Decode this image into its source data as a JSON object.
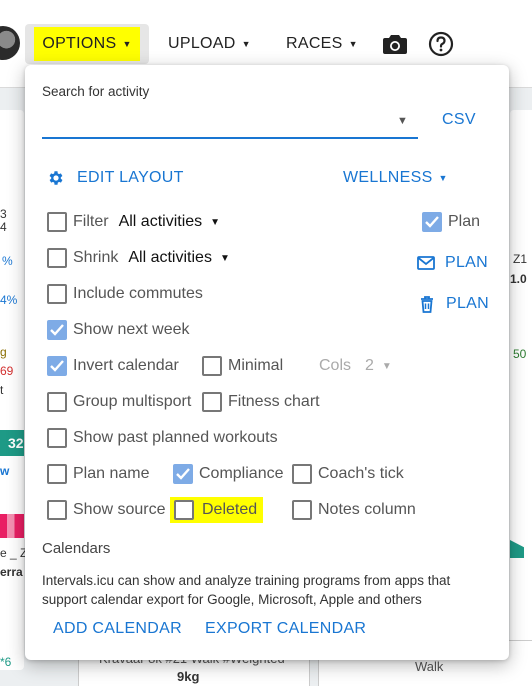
{
  "topbar": {
    "options_label": "OPTIONS",
    "upload_label": "UPLOAD",
    "races_label": "RACES"
  },
  "background": {
    "left_fragments": [
      "3",
      "4",
      "%",
      "4%",
      "g",
      "69",
      "t",
      "32",
      "w",
      "e _ Z",
      "erra",
      "*6"
    ],
    "right_fragments": [
      "Z1",
      "1.0",
      "50"
    ],
    "bottom_card_left": "Kravaar 8k #21 Walk #Weighted",
    "bottom_card_left_line2": "9kg",
    "bottom_card_right": "Walk"
  },
  "panel": {
    "search_label": "Search for activity",
    "search_value": "",
    "csv_label": "CSV",
    "edit_layout_label": "EDIT LAYOUT",
    "wellness_label": "WELLNESS",
    "filter": {
      "label": "Filter",
      "value": "All activities",
      "checked": false
    },
    "shrink": {
      "label": "Shrink",
      "value": "All activities",
      "checked": false
    },
    "plan_checkbox": {
      "label": "Plan",
      "checked": true
    },
    "plan_email_label": "PLAN",
    "plan_delete_label": "PLAN",
    "include_commutes": {
      "label": "Include commutes",
      "checked": false
    },
    "show_next_week": {
      "label": "Show next week",
      "checked": true
    },
    "invert_calendar": {
      "label": "Invert calendar",
      "checked": true
    },
    "minimal": {
      "label": "Minimal",
      "checked": false
    },
    "cols": {
      "label": "Cols",
      "value": "2"
    },
    "group_multisport": {
      "label": "Group multisport",
      "checked": false
    },
    "fitness_chart": {
      "label": "Fitness chart",
      "checked": false
    },
    "show_past_planned": {
      "label": "Show past planned workouts",
      "checked": false
    },
    "plan_name": {
      "label": "Plan name",
      "checked": false
    },
    "compliance": {
      "label": "Compliance",
      "checked": true
    },
    "coachs_tick": {
      "label": "Coach's tick",
      "checked": false
    },
    "show_source": {
      "label": "Show source",
      "checked": false
    },
    "deleted": {
      "label": "Deleted",
      "checked": false
    },
    "notes_column": {
      "label": "Notes column",
      "checked": false
    },
    "calendars_title": "Calendars",
    "calendars_desc": "Intervals.icu can show and analyze training programs from apps that support calendar export for Google, Microsoft, Apple and others",
    "add_calendar_label": "ADD CALENDAR",
    "export_calendar_label": "EXPORT CALENDAR"
  },
  "colors": {
    "accent": "#1976d2",
    "checked": "#7eabe6",
    "highlight": "#ffff00"
  }
}
